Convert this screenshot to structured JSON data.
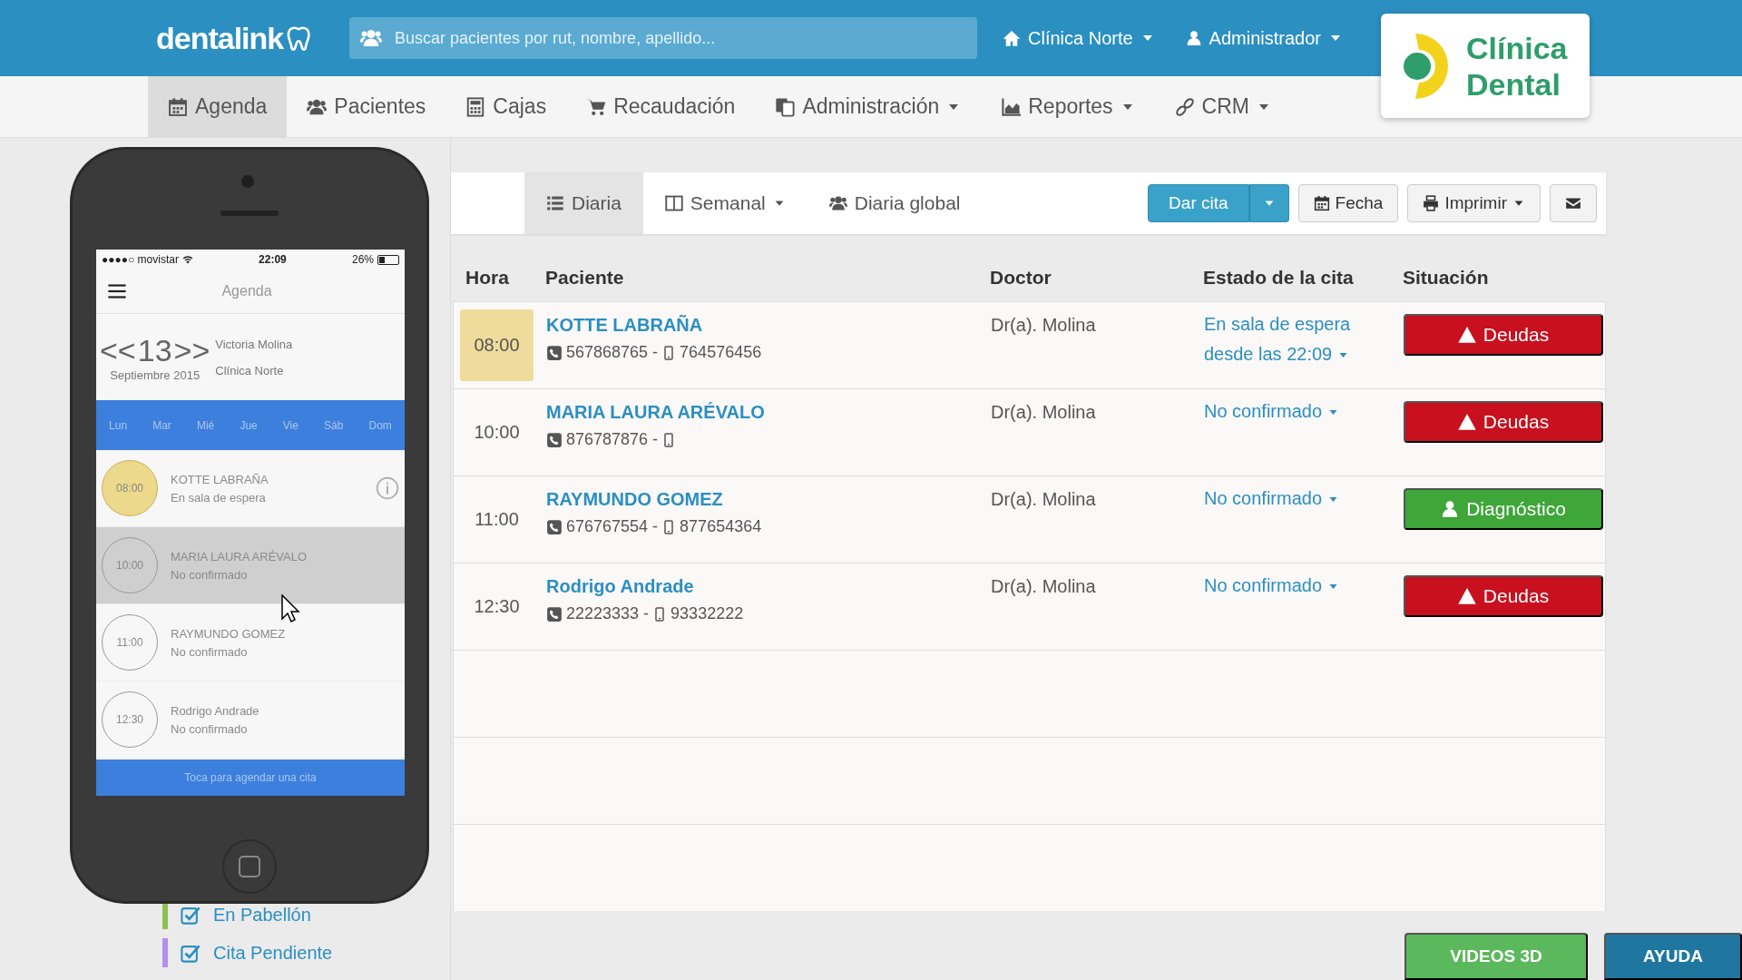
{
  "topbar": {
    "logo": "dentalink",
    "search": {
      "placeholder": "Buscar pacientes por rut, nombre, apellido..."
    },
    "clinic": "Clínica Norte",
    "user": "Administrador",
    "brand": [
      "Clínica",
      "Dental"
    ]
  },
  "nav": [
    {
      "label": "Agenda",
      "selected": true,
      "dropdown": false
    },
    {
      "label": "Pacientes",
      "selected": false,
      "dropdown": false
    },
    {
      "label": "Cajas",
      "selected": false,
      "dropdown": false
    },
    {
      "label": "Recaudación",
      "selected": false,
      "dropdown": false
    },
    {
      "label": "Administración",
      "selected": false,
      "dropdown": true
    },
    {
      "label": "Reportes",
      "selected": false,
      "dropdown": true
    },
    {
      "label": "CRM",
      "selected": false,
      "dropdown": true
    }
  ],
  "views": [
    {
      "label": "Diaria",
      "selected": true,
      "dropdown": false
    },
    {
      "label": "Semanal",
      "selected": false,
      "dropdown": true
    },
    {
      "label": "Diaria global",
      "selected": false,
      "dropdown": false
    }
  ],
  "actions": {
    "new": "Dar cita",
    "date": "Fecha",
    "print": "Imprimir"
  },
  "table": {
    "columns": [
      "Hora",
      "Paciente",
      "Doctor",
      "Estado de la cita",
      "Situación"
    ],
    "rows": [
      {
        "time": "08:00",
        "arrived": true,
        "patient": "KOTTE LABRAÑA",
        "phone": "567868765 -",
        "mobile": "764576456",
        "doctor": "Dr(a). Molina",
        "status": "En sala de espera desde las 22:09",
        "situation": {
          "kind": "debt",
          "label": "Deudas"
        }
      },
      {
        "time": "10:00",
        "arrived": false,
        "patient": "MARIA LAURA ARÉVALO",
        "phone": "876787876 -",
        "doctor": "Dr(a). Molina",
        "status": "No confirmado",
        "situation": {
          "kind": "debt",
          "label": "Deudas"
        }
      },
      {
        "time": "11:00",
        "arrived": false,
        "patient": "RAYMUNDO GOMEZ",
        "phone": "676767554 -",
        "mobile": "877654364",
        "doctor": "Dr(a). Molina",
        "status": "No confirmado",
        "situation": {
          "kind": "diagnosis",
          "label": "Diagnóstico"
        }
      },
      {
        "time": "12:30",
        "arrived": false,
        "patient": "Rodrigo Andrade",
        "phone": "22223333 -",
        "mobile": "93332222",
        "doctor": "Dr(a). Molina",
        "status": "No confirmado",
        "situation": {
          "kind": "debt",
          "label": "Deudas"
        }
      }
    ]
  },
  "legend": [
    {
      "label": "En Pabellón",
      "checked": true,
      "color": "#8cc152"
    },
    {
      "label": "Cita Pendiente",
      "checked": true,
      "color": "#b48ef0"
    }
  ],
  "phone": {
    "carrier": "●●●●○ movistar",
    "clock": "22:09",
    "battery": "26%",
    "title": "Agenda",
    "prev": "<<",
    "day": "13",
    "next": ">>",
    "month": "Septiembre 2015",
    "doctor": "Victoria Molina",
    "clinic": "Clínica Norte",
    "weekdays": [
      "Lun",
      "Mar",
      "Mié",
      "Jue",
      "Vie",
      "Sáb",
      "Dom"
    ],
    "appointments": [
      {
        "time": "08:00",
        "name": "KOTTE LABRAÑA",
        "status": "En sala de espera",
        "arrived": true,
        "selected": false
      },
      {
        "time": "10:00",
        "name": "MARIA LAURA ARÉVALO",
        "status": "No confirmado",
        "arrived": false,
        "selected": true
      },
      {
        "time": "11:00",
        "name": "RAYMUNDO GOMEZ",
        "status": "No confirmado",
        "arrived": false,
        "selected": false
      },
      {
        "time": "12:30",
        "name": "Rodrigo Andrade",
        "status": "No confirmado",
        "arrived": false,
        "selected": false
      }
    ],
    "footer": "Toca para agendar una cita"
  },
  "help": {
    "videos": "VIDEOS 3D",
    "help": "AYUDA"
  }
}
